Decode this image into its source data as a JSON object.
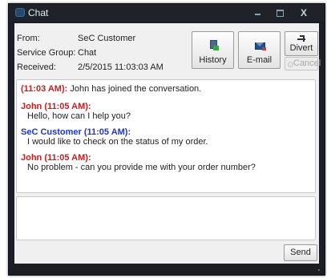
{
  "window": {
    "title": "Chat",
    "min_glyph": "",
    "close_glyph": "X"
  },
  "info": {
    "from_label": "From:",
    "from_value": "SeC Customer",
    "service_group_label": "Service Group:",
    "service_group_value": "Chat",
    "received_label": "Received:",
    "received_value": "2/5/2015 11:03:03 AM"
  },
  "toolbar": {
    "history_label": "History",
    "email_label": "E-mail",
    "divert_label": "Divert",
    "cancel_label": "Cancel"
  },
  "transcript": {
    "system_time": "(11:03 AM):",
    "system_text": "John has joined the conversation.",
    "messages": [
      {
        "header": "John (11:05 AM):",
        "text": "Hello, how can I help you?",
        "color": "#d21a1a"
      },
      {
        "header": "SeC Customer (11:05 AM):",
        "text": "I would like to check on the status of my order.",
        "color": "#1a35d4"
      },
      {
        "header": "John (11:05 AM):",
        "text": "No problem - can you provide me with your order number?",
        "color": "#d21a1a"
      }
    ]
  },
  "compose": {
    "value": "",
    "send_label": "Send"
  },
  "icons": {
    "title": "chat-window-icon",
    "history": "history-icon",
    "email": "email-icon",
    "divert": "divert-icon",
    "cancel": "cancel-icon"
  }
}
